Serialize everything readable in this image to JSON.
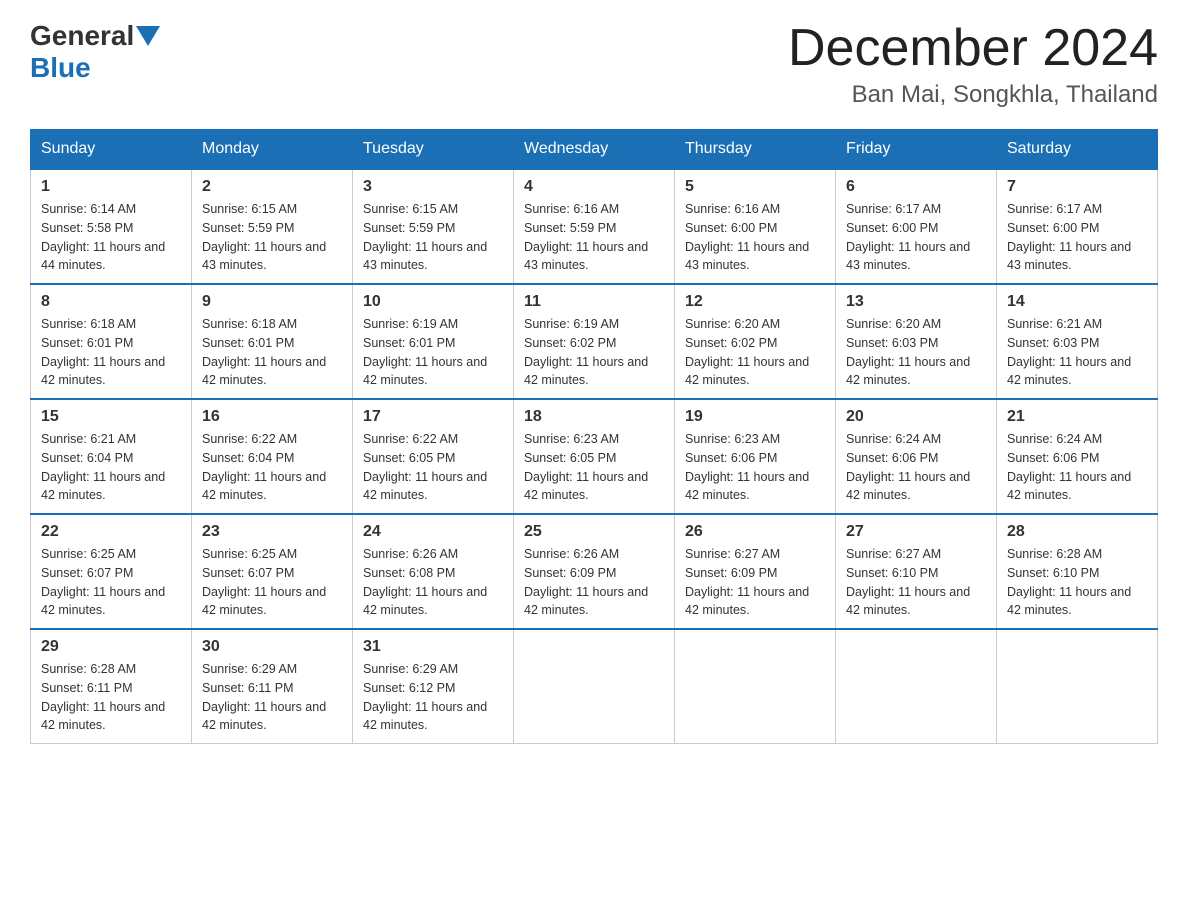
{
  "header": {
    "logo": {
      "part1": "General",
      "part2": "Blue"
    },
    "title": "December 2024",
    "subtitle": "Ban Mai, Songkhla, Thailand"
  },
  "days_of_week": [
    "Sunday",
    "Monday",
    "Tuesday",
    "Wednesday",
    "Thursday",
    "Friday",
    "Saturday"
  ],
  "weeks": [
    [
      {
        "day": 1,
        "sunrise": "6:14 AM",
        "sunset": "5:58 PM",
        "daylight": "11 hours and 44 minutes."
      },
      {
        "day": 2,
        "sunrise": "6:15 AM",
        "sunset": "5:59 PM",
        "daylight": "11 hours and 43 minutes."
      },
      {
        "day": 3,
        "sunrise": "6:15 AM",
        "sunset": "5:59 PM",
        "daylight": "11 hours and 43 minutes."
      },
      {
        "day": 4,
        "sunrise": "6:16 AM",
        "sunset": "5:59 PM",
        "daylight": "11 hours and 43 minutes."
      },
      {
        "day": 5,
        "sunrise": "6:16 AM",
        "sunset": "6:00 PM",
        "daylight": "11 hours and 43 minutes."
      },
      {
        "day": 6,
        "sunrise": "6:17 AM",
        "sunset": "6:00 PM",
        "daylight": "11 hours and 43 minutes."
      },
      {
        "day": 7,
        "sunrise": "6:17 AM",
        "sunset": "6:00 PM",
        "daylight": "11 hours and 43 minutes."
      }
    ],
    [
      {
        "day": 8,
        "sunrise": "6:18 AM",
        "sunset": "6:01 PM",
        "daylight": "11 hours and 42 minutes."
      },
      {
        "day": 9,
        "sunrise": "6:18 AM",
        "sunset": "6:01 PM",
        "daylight": "11 hours and 42 minutes."
      },
      {
        "day": 10,
        "sunrise": "6:19 AM",
        "sunset": "6:01 PM",
        "daylight": "11 hours and 42 minutes."
      },
      {
        "day": 11,
        "sunrise": "6:19 AM",
        "sunset": "6:02 PM",
        "daylight": "11 hours and 42 minutes."
      },
      {
        "day": 12,
        "sunrise": "6:20 AM",
        "sunset": "6:02 PM",
        "daylight": "11 hours and 42 minutes."
      },
      {
        "day": 13,
        "sunrise": "6:20 AM",
        "sunset": "6:03 PM",
        "daylight": "11 hours and 42 minutes."
      },
      {
        "day": 14,
        "sunrise": "6:21 AM",
        "sunset": "6:03 PM",
        "daylight": "11 hours and 42 minutes."
      }
    ],
    [
      {
        "day": 15,
        "sunrise": "6:21 AM",
        "sunset": "6:04 PM",
        "daylight": "11 hours and 42 minutes."
      },
      {
        "day": 16,
        "sunrise": "6:22 AM",
        "sunset": "6:04 PM",
        "daylight": "11 hours and 42 minutes."
      },
      {
        "day": 17,
        "sunrise": "6:22 AM",
        "sunset": "6:05 PM",
        "daylight": "11 hours and 42 minutes."
      },
      {
        "day": 18,
        "sunrise": "6:23 AM",
        "sunset": "6:05 PM",
        "daylight": "11 hours and 42 minutes."
      },
      {
        "day": 19,
        "sunrise": "6:23 AM",
        "sunset": "6:06 PM",
        "daylight": "11 hours and 42 minutes."
      },
      {
        "day": 20,
        "sunrise": "6:24 AM",
        "sunset": "6:06 PM",
        "daylight": "11 hours and 42 minutes."
      },
      {
        "day": 21,
        "sunrise": "6:24 AM",
        "sunset": "6:06 PM",
        "daylight": "11 hours and 42 minutes."
      }
    ],
    [
      {
        "day": 22,
        "sunrise": "6:25 AM",
        "sunset": "6:07 PM",
        "daylight": "11 hours and 42 minutes."
      },
      {
        "day": 23,
        "sunrise": "6:25 AM",
        "sunset": "6:07 PM",
        "daylight": "11 hours and 42 minutes."
      },
      {
        "day": 24,
        "sunrise": "6:26 AM",
        "sunset": "6:08 PM",
        "daylight": "11 hours and 42 minutes."
      },
      {
        "day": 25,
        "sunrise": "6:26 AM",
        "sunset": "6:09 PM",
        "daylight": "11 hours and 42 minutes."
      },
      {
        "day": 26,
        "sunrise": "6:27 AM",
        "sunset": "6:09 PM",
        "daylight": "11 hours and 42 minutes."
      },
      {
        "day": 27,
        "sunrise": "6:27 AM",
        "sunset": "6:10 PM",
        "daylight": "11 hours and 42 minutes."
      },
      {
        "day": 28,
        "sunrise": "6:28 AM",
        "sunset": "6:10 PM",
        "daylight": "11 hours and 42 minutes."
      }
    ],
    [
      {
        "day": 29,
        "sunrise": "6:28 AM",
        "sunset": "6:11 PM",
        "daylight": "11 hours and 42 minutes."
      },
      {
        "day": 30,
        "sunrise": "6:29 AM",
        "sunset": "6:11 PM",
        "daylight": "11 hours and 42 minutes."
      },
      {
        "day": 31,
        "sunrise": "6:29 AM",
        "sunset": "6:12 PM",
        "daylight": "11 hours and 42 minutes."
      },
      null,
      null,
      null,
      null
    ]
  ]
}
